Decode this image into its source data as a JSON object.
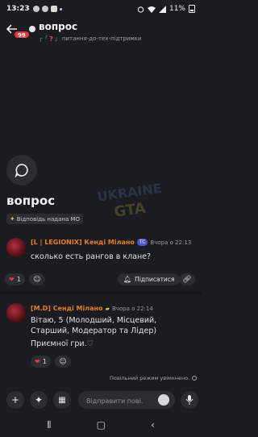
{
  "status_bar": {
    "time": "13:23",
    "battery": "11%"
  },
  "header": {
    "unread_badge": "99",
    "title": "вопрос",
    "channel": "питання-до-тех-підтримки"
  },
  "thread": {
    "name": "вопрос",
    "tag": "Відповідь надана МО"
  },
  "messages": [
    {
      "author": "[L | LEGIONIX] Кенді Мілано",
      "role_badge": "TC",
      "timestamp": "Вчора о 22:13",
      "text": "сколько есть рангов в клане?",
      "reaction_count": "1",
      "follow_label": "Підписатися"
    },
    {
      "author": "[M.D] Сенді Мілано",
      "timestamp": "Вчора о 22:14",
      "text": "Вітаю, 5 (Молодший, Місцевий, Старший, Модератор та Лідер)",
      "text2": "Приємної гри.",
      "reaction_count": "1"
    }
  ],
  "slowmode_text": "Повільний режим увімкнено.",
  "composer": {
    "placeholder": "Відправити пові..."
  },
  "watermark_text": "UKRAINE GTA",
  "colors": {
    "background": "#1b1c21",
    "author": "#e67e22",
    "accent": "#4a57c9",
    "heart": "#e0393e"
  }
}
